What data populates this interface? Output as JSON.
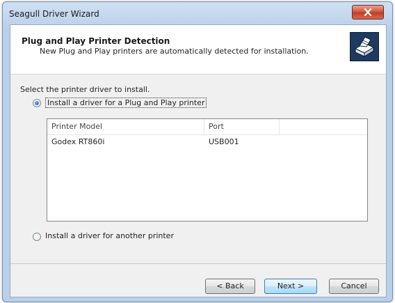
{
  "window": {
    "title": "Seagull Driver Wizard"
  },
  "header": {
    "title": "Plug and Play Printer Detection",
    "subtitle": "New Plug and Play printers are automatically detected for installation."
  },
  "instruction": "Select the printer driver to install.",
  "options": {
    "pnp": {
      "label": "Install a driver for a Plug and Play printer",
      "selected": true
    },
    "other": {
      "label": "Install a driver for another printer",
      "selected": false
    }
  },
  "printer_list": {
    "columns": [
      "Printer Model",
      "Port",
      ""
    ],
    "rows": [
      {
        "model": "Godex RT860i",
        "port": "USB001"
      }
    ]
  },
  "buttons": {
    "back": "< Back",
    "next": "Next >",
    "cancel": "Cancel"
  },
  "icons": {
    "close": "close-icon",
    "printer": "printer-icon"
  }
}
